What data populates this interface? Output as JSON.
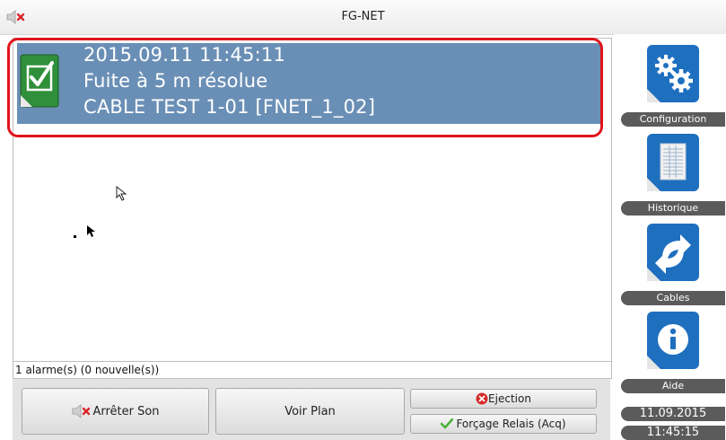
{
  "window": {
    "title": "FG-NET"
  },
  "alarm": {
    "datetime": "2015.09.11 11:45:11",
    "message": "Fuite à 5 m  résolue",
    "cable": "CABLE TEST 1-01 [FNET_1_02]",
    "icon": "checkbox-checked-icon"
  },
  "status": {
    "text": "1 alarme(s) (0 nouvelle(s))"
  },
  "buttons": {
    "stop_sound": "Arrêter Son",
    "view_plan": "Voir Plan",
    "ejection": "Ejection",
    "relay_force": "Forçage Relais (Acq)"
  },
  "sidebar": {
    "items": [
      {
        "label": "Configuration",
        "icon": "gears-icon"
      },
      {
        "label": "Historique",
        "icon": "document-icon"
      },
      {
        "label": "Cables",
        "icon": "arrows-icon"
      },
      {
        "label": "Aide",
        "icon": "info-icon"
      }
    ],
    "date": "11.09.2015",
    "time": "11:45:15"
  },
  "colors": {
    "alarm_bg": "#6a8fb6",
    "highlight": "#e0141c",
    "tile_blue": "#1f6fbf",
    "label_bg": "#5b5b5b"
  }
}
